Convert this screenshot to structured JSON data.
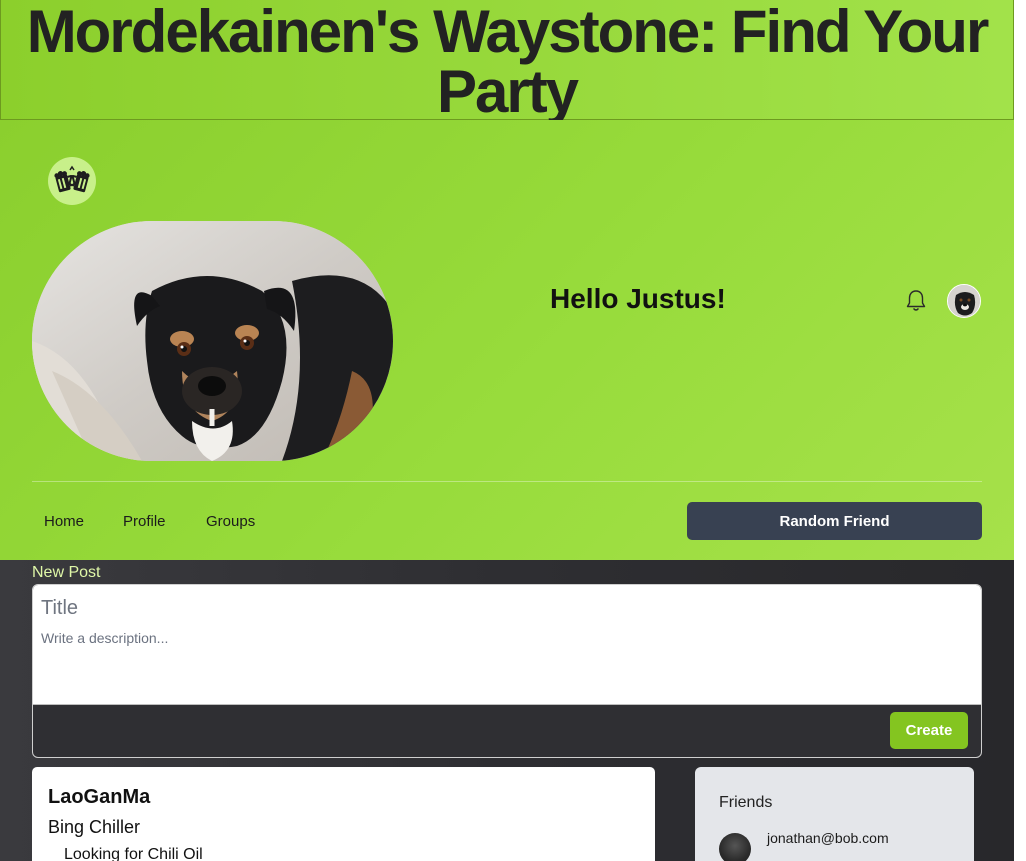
{
  "site": {
    "title": "Mordekainen's Waystone: Find Your Party"
  },
  "header": {
    "logo_icon": "beer-mugs-icon",
    "greeting": "Hello Justus!",
    "notification_icon": "bell-icon",
    "avatar_icon": "user-avatar",
    "hero_image": "dog-photo"
  },
  "nav": {
    "items": [
      {
        "label": "Home"
      },
      {
        "label": "Profile"
      },
      {
        "label": "Groups"
      }
    ],
    "random_friend_label": "Random Friend"
  },
  "new_post": {
    "label": "New Post",
    "title_placeholder": "Title",
    "description_placeholder": "Write a description...",
    "create_label": "Create"
  },
  "posts": [
    {
      "author": "LaoGanMa",
      "title": "Bing Chiller",
      "body": "Looking for Chili Oil"
    }
  ],
  "friends": {
    "title": "Friends",
    "items": [
      {
        "email": "jonathan@bob.com"
      }
    ]
  },
  "colors": {
    "accent_green": "#84c520",
    "header_green": "#98dc3c",
    "nav_button": "#384152",
    "dark_bg": "#2e2e32"
  }
}
